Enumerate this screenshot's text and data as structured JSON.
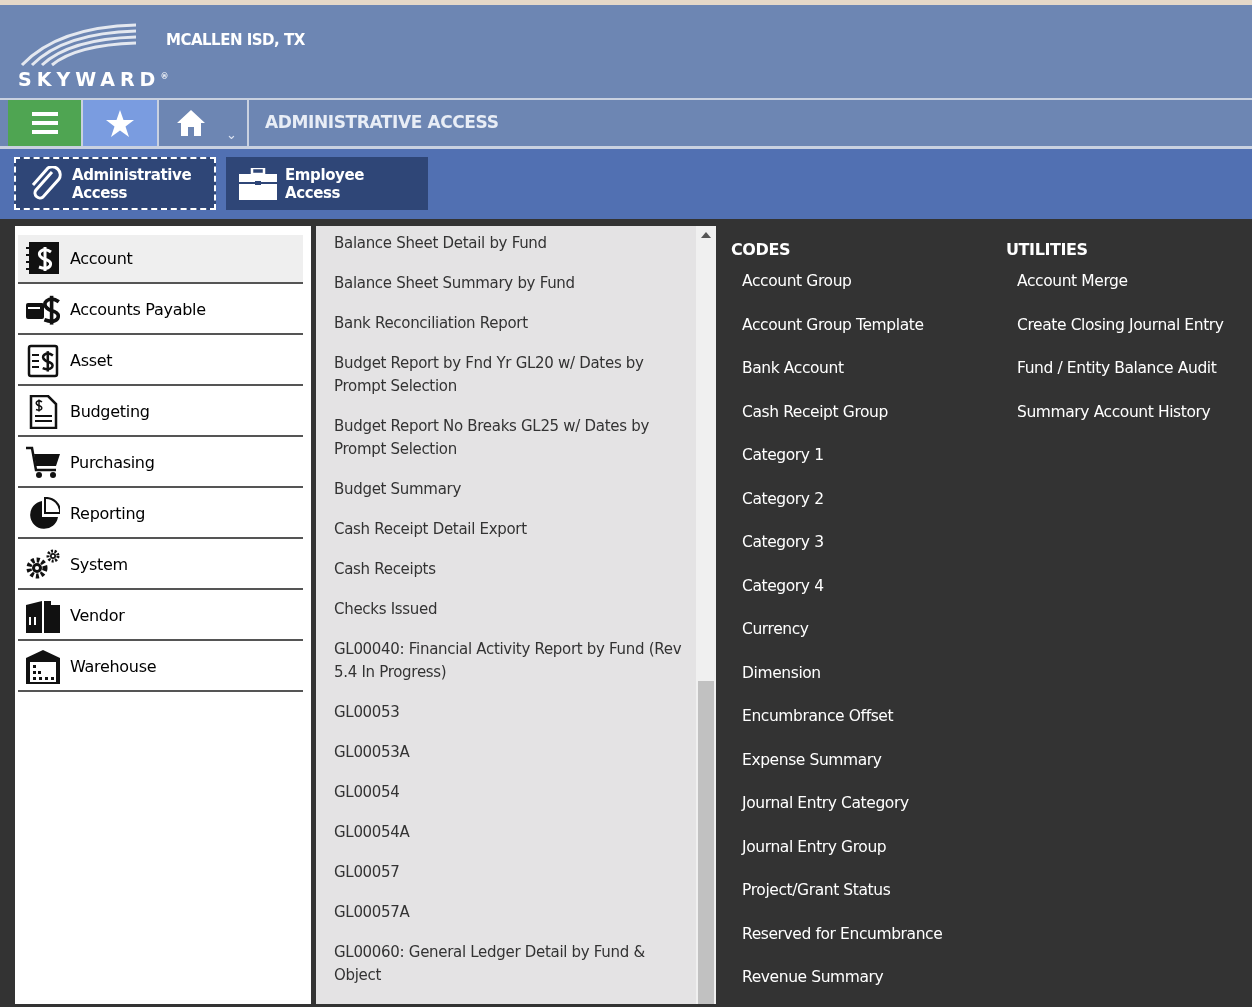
{
  "header": {
    "logo_text": "SKYWARD$^{®}$",
    "district": "MCALLEN ISD, TX"
  },
  "nav": {
    "title": "ADMINISTRATIVE ACCESS",
    "dropdown": "⌄"
  },
  "access_tabs": [
    {
      "label": "Administrative Access",
      "kind": "clip",
      "selected": true
    },
    {
      "label": "Employee Access",
      "kind": "briefcase",
      "selected": false
    }
  ],
  "sidebar": {
    "items": [
      {
        "label": "Account",
        "kind": "account",
        "selected": true
      },
      {
        "label": "Accounts Payable",
        "kind": "payable",
        "selected": false
      },
      {
        "label": "Asset",
        "kind": "asset",
        "selected": false
      },
      {
        "label": "Budgeting",
        "kind": "budget",
        "selected": false
      },
      {
        "label": "Purchasing",
        "kind": "cart",
        "selected": false
      },
      {
        "label": "Reporting",
        "kind": "pie",
        "selected": false
      },
      {
        "label": "System",
        "kind": "gears",
        "selected": false
      },
      {
        "label": "Vendor",
        "kind": "vendor",
        "selected": false
      },
      {
        "label": "Warehouse",
        "kind": "warehouse",
        "selected": false
      }
    ]
  },
  "reports": [
    "Balance Sheet Detail by Fund",
    "Balance Sheet Summary by Fund",
    "Bank Reconciliation Report",
    "Budget Report by Fnd Yr GL20 w/ Dates by Prompt Selection",
    "Budget Report No Breaks GL25 w/ Dates by Prompt Selection",
    "Budget Summary",
    "Cash Receipt Detail Export",
    "Cash Receipts",
    "Checks Issued",
    "GL00040: Financial Activity Report by Fund (Rev 5.4 In Progress)",
    "GL00053",
    "GL00053A",
    "GL00054",
    "GL00054A",
    "GL00057",
    "GL00057A",
    "GL00060: General Ledger Detail by Fund & Object"
  ],
  "sections": [
    {
      "heading": "CODES",
      "items": [
        "Account Group",
        "Account Group Template",
        "Bank Account",
        "Cash Receipt Group",
        "Category 1",
        "Category 2",
        "Category 3",
        "Category 4",
        "Currency",
        "Dimension",
        "Encumbrance Offset",
        "Expense Summary",
        "Journal Entry Category",
        "Journal Entry Group",
        "Project/Grant Status",
        "Reserved for Encumbrance",
        "Revenue Summary"
      ]
    },
    {
      "heading": "UTILITIES",
      "items": [
        "Account Merge",
        "Create Closing Journal Entry",
        "Fund / Entity Balance Audit",
        "Summary Account History"
      ]
    }
  ]
}
